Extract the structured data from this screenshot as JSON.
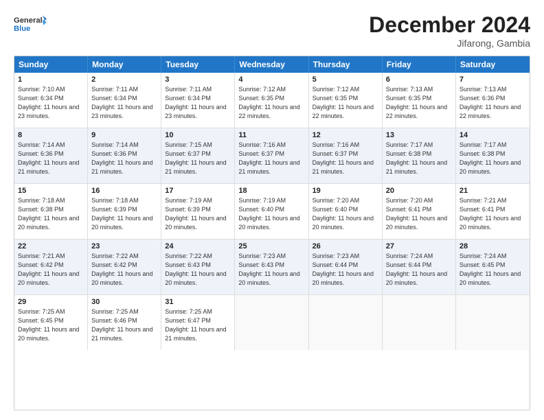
{
  "header": {
    "logo": {
      "general": "General",
      "blue": "Blue"
    },
    "title": "December 2024",
    "location": "Jifarong, Gambia"
  },
  "calendar": {
    "days_of_week": [
      "Sunday",
      "Monday",
      "Tuesday",
      "Wednesday",
      "Thursday",
      "Friday",
      "Saturday"
    ],
    "weeks": [
      [
        {
          "day": "",
          "empty": true
        },
        {
          "day": "",
          "empty": true
        },
        {
          "day": "",
          "empty": true
        },
        {
          "day": "",
          "empty": true
        },
        {
          "day": "",
          "empty": true
        },
        {
          "day": "",
          "empty": true
        },
        {
          "day": "",
          "empty": true
        }
      ],
      [
        {
          "day": "1",
          "sunrise": "7:10 AM",
          "sunset": "6:34 PM",
          "daylight": "11 hours and 23 minutes."
        },
        {
          "day": "2",
          "sunrise": "7:11 AM",
          "sunset": "6:34 PM",
          "daylight": "11 hours and 23 minutes."
        },
        {
          "day": "3",
          "sunrise": "7:11 AM",
          "sunset": "6:34 PM",
          "daylight": "11 hours and 23 minutes."
        },
        {
          "day": "4",
          "sunrise": "7:12 AM",
          "sunset": "6:35 PM",
          "daylight": "11 hours and 22 minutes."
        },
        {
          "day": "5",
          "sunrise": "7:12 AM",
          "sunset": "6:35 PM",
          "daylight": "11 hours and 22 minutes."
        },
        {
          "day": "6",
          "sunrise": "7:13 AM",
          "sunset": "6:35 PM",
          "daylight": "11 hours and 22 minutes."
        },
        {
          "day": "7",
          "sunrise": "7:13 AM",
          "sunset": "6:36 PM",
          "daylight": "11 hours and 22 minutes."
        }
      ],
      [
        {
          "day": "8",
          "sunrise": "7:14 AM",
          "sunset": "6:36 PM",
          "daylight": "11 hours and 21 minutes."
        },
        {
          "day": "9",
          "sunrise": "7:14 AM",
          "sunset": "6:36 PM",
          "daylight": "11 hours and 21 minutes."
        },
        {
          "day": "10",
          "sunrise": "7:15 AM",
          "sunset": "6:37 PM",
          "daylight": "11 hours and 21 minutes."
        },
        {
          "day": "11",
          "sunrise": "7:16 AM",
          "sunset": "6:37 PM",
          "daylight": "11 hours and 21 minutes."
        },
        {
          "day": "12",
          "sunrise": "7:16 AM",
          "sunset": "6:37 PM",
          "daylight": "11 hours and 21 minutes."
        },
        {
          "day": "13",
          "sunrise": "7:17 AM",
          "sunset": "6:38 PM",
          "daylight": "11 hours and 21 minutes."
        },
        {
          "day": "14",
          "sunrise": "7:17 AM",
          "sunset": "6:38 PM",
          "daylight": "11 hours and 20 minutes."
        }
      ],
      [
        {
          "day": "15",
          "sunrise": "7:18 AM",
          "sunset": "6:38 PM",
          "daylight": "11 hours and 20 minutes."
        },
        {
          "day": "16",
          "sunrise": "7:18 AM",
          "sunset": "6:39 PM",
          "daylight": "11 hours and 20 minutes."
        },
        {
          "day": "17",
          "sunrise": "7:19 AM",
          "sunset": "6:39 PM",
          "daylight": "11 hours and 20 minutes."
        },
        {
          "day": "18",
          "sunrise": "7:19 AM",
          "sunset": "6:40 PM",
          "daylight": "11 hours and 20 minutes."
        },
        {
          "day": "19",
          "sunrise": "7:20 AM",
          "sunset": "6:40 PM",
          "daylight": "11 hours and 20 minutes."
        },
        {
          "day": "20",
          "sunrise": "7:20 AM",
          "sunset": "6:41 PM",
          "daylight": "11 hours and 20 minutes."
        },
        {
          "day": "21",
          "sunrise": "7:21 AM",
          "sunset": "6:41 PM",
          "daylight": "11 hours and 20 minutes."
        }
      ],
      [
        {
          "day": "22",
          "sunrise": "7:21 AM",
          "sunset": "6:42 PM",
          "daylight": "11 hours and 20 minutes."
        },
        {
          "day": "23",
          "sunrise": "7:22 AM",
          "sunset": "6:42 PM",
          "daylight": "11 hours and 20 minutes."
        },
        {
          "day": "24",
          "sunrise": "7:22 AM",
          "sunset": "6:43 PM",
          "daylight": "11 hours and 20 minutes."
        },
        {
          "day": "25",
          "sunrise": "7:23 AM",
          "sunset": "6:43 PM",
          "daylight": "11 hours and 20 minutes."
        },
        {
          "day": "26",
          "sunrise": "7:23 AM",
          "sunset": "6:44 PM",
          "daylight": "11 hours and 20 minutes."
        },
        {
          "day": "27",
          "sunrise": "7:24 AM",
          "sunset": "6:44 PM",
          "daylight": "11 hours and 20 minutes."
        },
        {
          "day": "28",
          "sunrise": "7:24 AM",
          "sunset": "6:45 PM",
          "daylight": "11 hours and 20 minutes."
        }
      ],
      [
        {
          "day": "29",
          "sunrise": "7:25 AM",
          "sunset": "6:45 PM",
          "daylight": "11 hours and 20 minutes."
        },
        {
          "day": "30",
          "sunrise": "7:25 AM",
          "sunset": "6:46 PM",
          "daylight": "11 hours and 21 minutes."
        },
        {
          "day": "31",
          "sunrise": "7:25 AM",
          "sunset": "6:47 PM",
          "daylight": "11 hours and 21 minutes."
        },
        {
          "day": "",
          "empty": true
        },
        {
          "day": "",
          "empty": true
        },
        {
          "day": "",
          "empty": true
        },
        {
          "day": "",
          "empty": true
        }
      ]
    ]
  }
}
